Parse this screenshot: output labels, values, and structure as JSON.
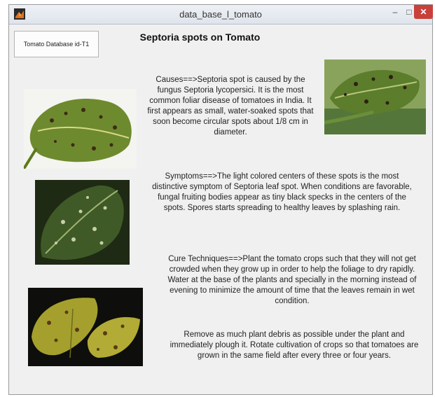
{
  "window": {
    "title": "data_base_l_tomato",
    "controls": {
      "minimize": "–",
      "maximize": "□",
      "close": "✕"
    }
  },
  "tab_button": {
    "label": "Tomato Database id-T1"
  },
  "heading": "Septoria spots on Tomato",
  "sections": {
    "causes": "Causes==>Septoria spot is caused by the fungus Septoria lycopersici. It is the most common foliar disease of tomatoes in India. It first appears as small, water-soaked spots that soon become circular spots about 1/8 cm in diameter.",
    "symptoms": "Symptoms==>The light colored centers of these spots is the most distinctive symptom of Septoria leaf spot. When conditions are favorable, fungal fruiting bodies appear as tiny black specks in the centers of the spots. Spores starts spreading to healthy leaves by splashing rain.",
    "cure": "Cure Techniques==>Plant the tomato crops such that they will not get crowded when they grow up in order to help the foliage to dry rapidly. Water at the base of the plants and specially in the morning instead of evening to minimize the amount of time that the leaves remain in wet condition.",
    "remove": "Remove as much plant debris as possible under the plant and immediately plough it. Rotate cultivation of crops so that tomatoes are grown in the same field after every three or four years."
  },
  "colors": {
    "close": "#c9403a",
    "window_bg": "#f0f0f0"
  }
}
